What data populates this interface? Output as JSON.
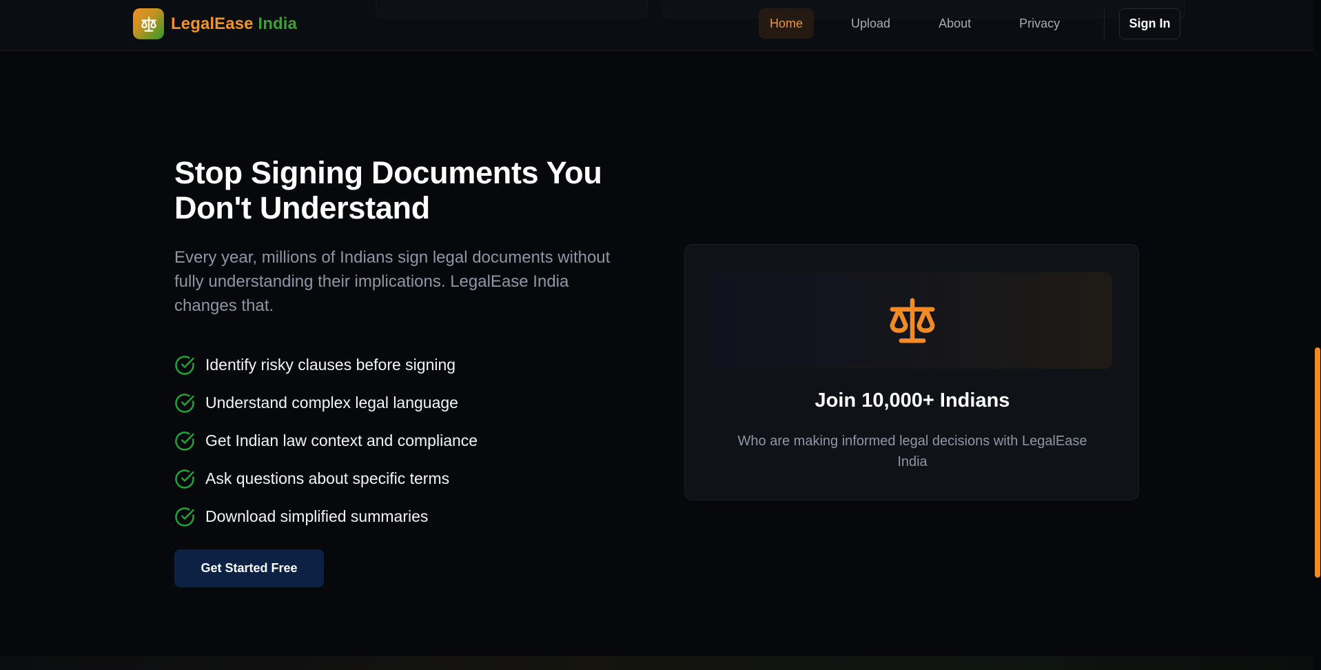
{
  "brand": {
    "name_part1": "LegalEase",
    "name_part2": "India",
    "logo_icon": "scales-icon"
  },
  "nav": {
    "items": [
      {
        "label": "Home",
        "active": true
      },
      {
        "label": "Upload",
        "active": false
      },
      {
        "label": "About",
        "active": false
      },
      {
        "label": "Privacy",
        "active": false
      }
    ],
    "signin_label": "Sign In"
  },
  "hero": {
    "title": "Stop Signing Documents You Don't Understand",
    "subtitle": "Every year, millions of Indians sign legal documents without fully understanding their implications. LegalEase India changes that.",
    "features": [
      "Identify risky clauses before signing",
      "Understand complex legal language",
      "Get Indian law context and compliance",
      "Ask questions about specific terms",
      "Download simplified summaries"
    ],
    "feature_icon": "check-circle-icon",
    "cta_label": "Get Started Free"
  },
  "card": {
    "icon": "scales-icon",
    "title": "Join 10,000+ Indians",
    "text": "Who are making informed legal decisions with LegalEase India"
  },
  "colors": {
    "accent_orange": "#f39336",
    "accent_green": "#3f9f34",
    "check_green": "#22a33a",
    "cta_bg": "#0c2244",
    "page_bg": "#06080b"
  }
}
